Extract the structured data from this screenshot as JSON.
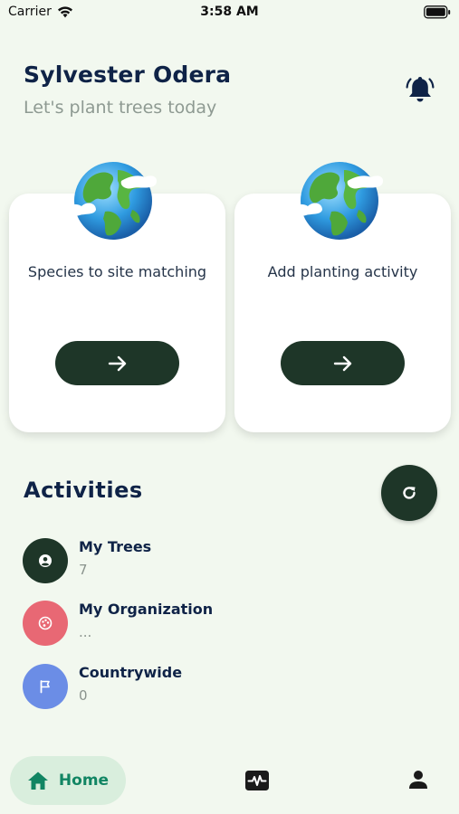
{
  "status_bar": {
    "carrier": "Carrier",
    "time": "3:58 AM"
  },
  "header": {
    "user_name": "Sylvester Odera",
    "subtitle": "Let's  plant trees today"
  },
  "cards": [
    {
      "label": "Species to site matching",
      "icon": "globe-icon",
      "button_icon": "arrow-right-icon"
    },
    {
      "label": "Add planting activity",
      "icon": "globe-icon",
      "button_icon": "arrow-right-icon"
    }
  ],
  "activities": {
    "title": "Activities",
    "items": [
      {
        "name": "My Trees",
        "value": "7",
        "icon": "user-circle-icon",
        "color": "#1e3628"
      },
      {
        "name": "My Organization",
        "value": "...",
        "icon": "palette-icon",
        "color": "#e86874"
      },
      {
        "name": "Countrywide",
        "value": "0",
        "icon": "flag-icon",
        "color": "#6b8de6"
      }
    ]
  },
  "bottom_nav": {
    "home_label": "Home",
    "items": [
      "home-icon",
      "activity-icon",
      "profile-icon"
    ]
  },
  "colors": {
    "accent": "#1e3628",
    "background": "#f2f8ef",
    "home_active": "#118563"
  }
}
